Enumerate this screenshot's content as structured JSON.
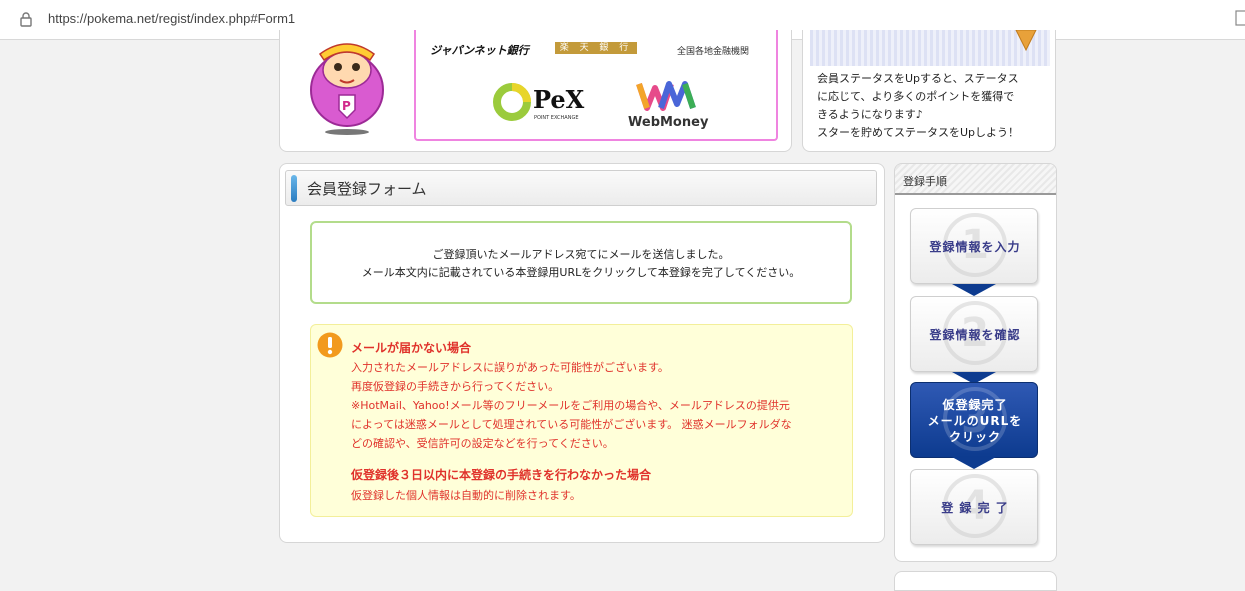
{
  "browser": {
    "url": "https://pokema.net/regist/index.php#Form1"
  },
  "banner": {
    "banks": [
      "ジャパンネット銀行",
      "楽 天 銀 行",
      "全国各地金融機関"
    ],
    "logos": [
      "PeX",
      "POINT EXCHANGE",
      "WebMoney"
    ]
  },
  "status": {
    "lines": [
      "会員ステータスをUpすると、ステータス",
      "に応じて、より多くのポイントを獲得で",
      "きるようになります♪",
      "スターを貯めてステータスをUpしよう！"
    ]
  },
  "form": {
    "title": "会員登録フォーム",
    "notice": [
      "ご登録頂いたメールアドレス宛てにメールを送信しました。",
      "メール本文内に記載されている本登録用URLをクリックして本登録を完了してください。"
    ],
    "warning": {
      "heading1": "メールが届かない場合",
      "body1": [
        "入力されたメールアドレスに誤りがあった可能性がございます。",
        "再度仮登録の手続きから行ってください。",
        "※HotMail、Yahoo!メール等のフリーメールをご利用の場合や、メールアドレスの提供元",
        "によっては迷惑メールとして処理されている可能性がございます。 迷惑メールフォルダな",
        "どの確認や、受信許可の設定などを行ってください。"
      ],
      "heading2": "仮登録後３日以内に本登録の手続きを行わなかった場合",
      "body2": "仮登録した個人情報は自動的に削除されます。"
    }
  },
  "steps": {
    "title": "登録手順",
    "items": [
      {
        "num": "1",
        "lines": [
          "登録情報を入力"
        ]
      },
      {
        "num": "2",
        "lines": [
          "登録情報を確認"
        ]
      },
      {
        "num": "3",
        "lines": [
          "仮登録完了",
          "メールのURLを",
          "クリック"
        ]
      },
      {
        "num": "4",
        "lines": [
          "登 録 完 了"
        ]
      }
    ],
    "active_index": 2
  },
  "colors": {
    "warning_text": "#e0322b",
    "active_step": "#0d3b8f",
    "notice_border": "#b3dc8b",
    "warning_bg": "#ffffd9"
  }
}
